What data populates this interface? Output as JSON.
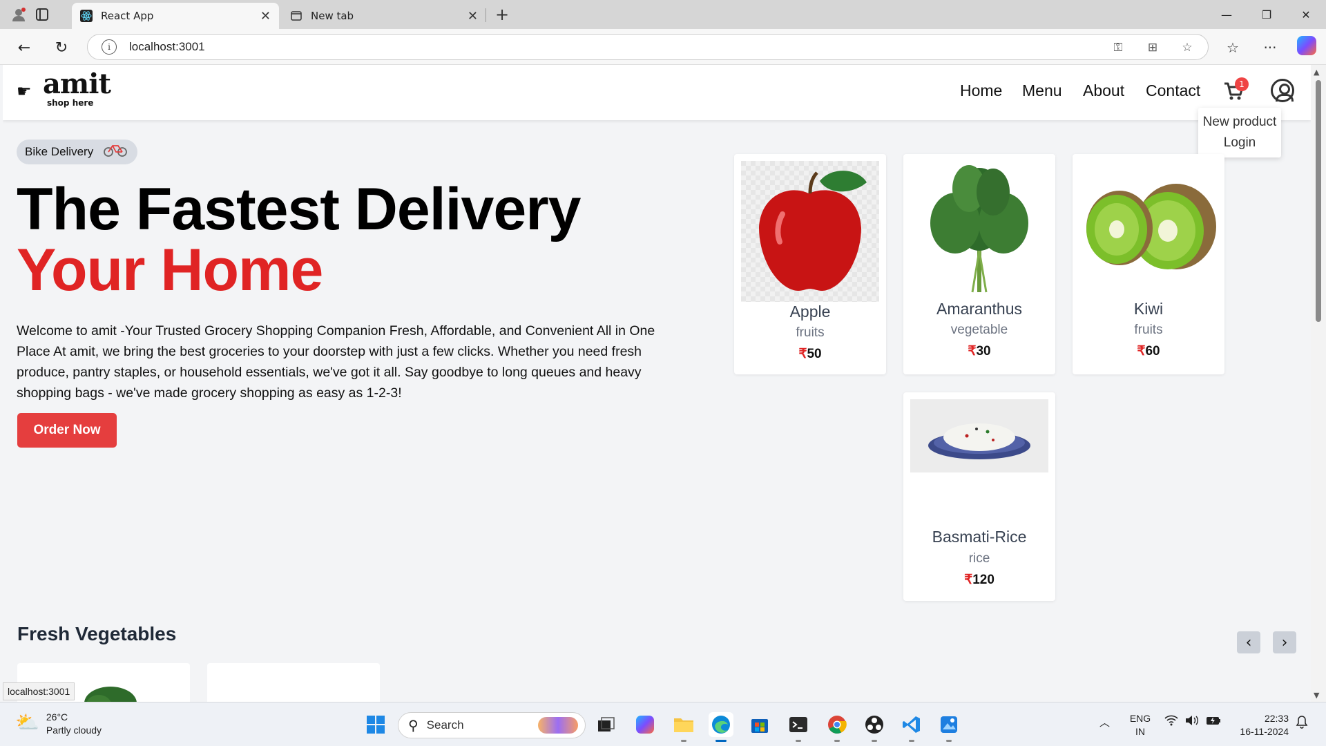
{
  "browser": {
    "tabs": [
      {
        "title": "React App",
        "active": true
      },
      {
        "title": "New tab",
        "active": false
      }
    ],
    "url": "localhost:3001",
    "status_url": "localhost:3001"
  },
  "site": {
    "logo_name": "amit",
    "logo_tagline": "shop here",
    "menu": [
      "Home",
      "Menu",
      "About",
      "Contact"
    ],
    "cart_count": "1",
    "dropdown": [
      "New product",
      "Login"
    ]
  },
  "hero": {
    "pill_label": "Bike Delivery",
    "title_line1": "The Fastest Delivery",
    "title_line2": "Your Home",
    "description": "Welcome to amit -Your Trusted Grocery Shopping Companion Fresh, Affordable, and Convenient All in One Place At amit, we bring the best groceries to your doorstep with just a few clicks. Whether you need fresh produce, pantry staples, or household essentials, we've got it all. Say goodbye to long queues and heavy shopping bags - we've made grocery shopping as easy as 1-2-3!",
    "order_button": "Order Now"
  },
  "products": [
    {
      "name": "Apple",
      "category": "fruits",
      "currency": "₹",
      "price": "50"
    },
    {
      "name": "Amaranthus",
      "category": "vegetable",
      "currency": "₹",
      "price": "30"
    },
    {
      "name": "Kiwi",
      "category": "fruits",
      "currency": "₹",
      "price": "60"
    },
    {
      "name": "Basmati-Rice",
      "category": "rice",
      "currency": "₹",
      "price": "120"
    }
  ],
  "sections": {
    "fresh_vegetables": "Fresh Vegetables"
  },
  "taskbar": {
    "weather_temp": "26°C",
    "weather_desc": "Partly cloudy",
    "search_label": "Search",
    "lang_line1": "ENG",
    "lang_line2": "IN",
    "time": "22:33",
    "date": "16-11-2024"
  },
  "colors": {
    "accent_red": "#e02424",
    "button_red": "#e53e3e",
    "page_bg": "#f3f4f6"
  }
}
